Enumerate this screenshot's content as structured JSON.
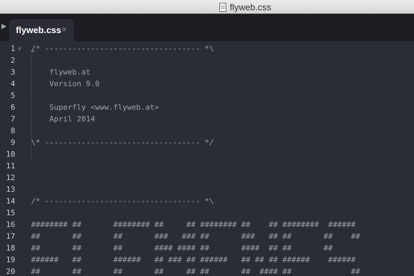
{
  "window": {
    "title": "flyweb.css",
    "title_icon": "document-icon"
  },
  "tabs": [
    {
      "label": "flyweb.css",
      "close_glyph": "×",
      "active": true
    }
  ],
  "sidebar_toggle_glyph": "▶",
  "editor": {
    "lines": [
      {
        "num": "1",
        "text": "/* ---------------------------------- *\\",
        "foldable": true
      },
      {
        "num": "2",
        "text": ""
      },
      {
        "num": "3",
        "text": "    flyweb.at"
      },
      {
        "num": "4",
        "text": "    Version 9.0"
      },
      {
        "num": "5",
        "text": ""
      },
      {
        "num": "6",
        "text": "    Superfly <www.flyweb.at>"
      },
      {
        "num": "7",
        "text": "    April 2014"
      },
      {
        "num": "8",
        "text": ""
      },
      {
        "num": "9",
        "text": "\\* ---------------------------------- */"
      },
      {
        "num": "10",
        "text": ""
      },
      {
        "num": "11",
        "text": ""
      },
      {
        "num": "12",
        "text": ""
      },
      {
        "num": "13",
        "text": ""
      },
      {
        "num": "14",
        "text": "/* ---------------------------------- *\\"
      },
      {
        "num": "15",
        "text": ""
      },
      {
        "num": "16",
        "text": "######## ##       ######## ##     ## ######## ##    ## ########  ######"
      },
      {
        "num": "17",
        "text": "##       ##       ##       ###   ### ##       ###   ## ##       ##    ##"
      },
      {
        "num": "18",
        "text": "##       ##       ##       #### #### ##       ####  ## ##       ##"
      },
      {
        "num": "19",
        "text": "######   ##       ######   ## ### ## ######   ## ## ## ######    ######"
      },
      {
        "num": "20",
        "text": "##       ##       ##       ##     ## ##       ##  #### ##             ##"
      }
    ]
  },
  "colors": {
    "editor_bg": "#2a2d35",
    "tabbar_bg": "#1b1d22",
    "code_text": "#9aa3ae",
    "line_numbers": "#c9cdd3"
  }
}
